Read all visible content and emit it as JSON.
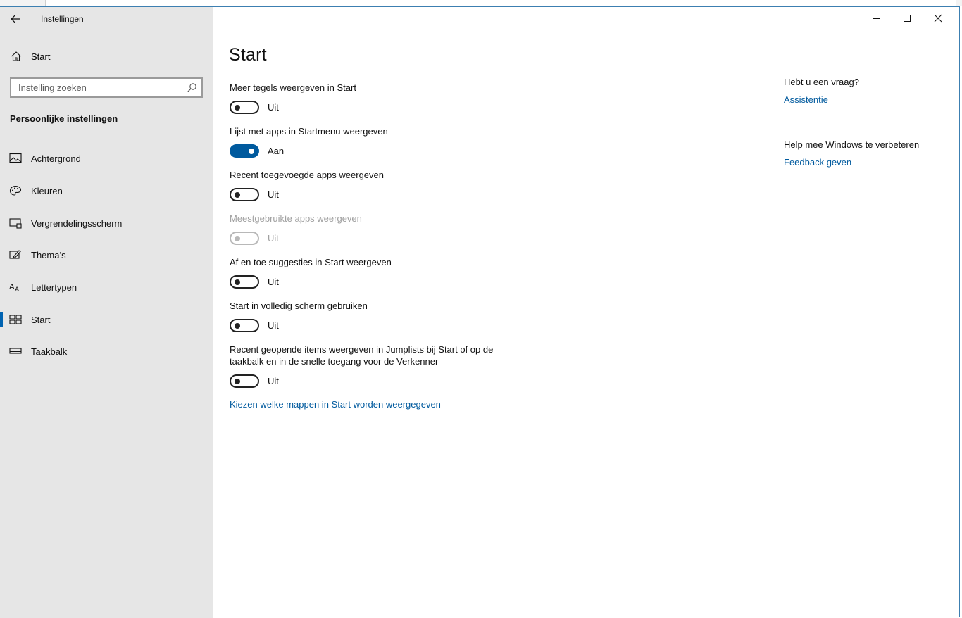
{
  "app": {
    "title": "Instellingen"
  },
  "sidebar": {
    "home_label": "Start",
    "search_placeholder": "Instelling zoeken",
    "section_heading": "Persoonlijke instellingen",
    "items": [
      {
        "label": "Achtergrond",
        "icon": "image-icon"
      },
      {
        "label": "Kleuren",
        "icon": "palette-icon"
      },
      {
        "label": "Vergrendelingsscherm",
        "icon": "lock-screen-icon"
      },
      {
        "label": "Thema’s",
        "icon": "theme-icon"
      },
      {
        "label": "Lettertypen",
        "icon": "font-icon"
      },
      {
        "label": "Start",
        "icon": "start-icon",
        "selected": true
      },
      {
        "label": "Taakbalk",
        "icon": "taskbar-icon"
      }
    ]
  },
  "main": {
    "title": "Start",
    "settings": [
      {
        "label": "Meer tegels weergeven in Start",
        "state": "Uit",
        "on": false,
        "disabled": false
      },
      {
        "label": "Lijst met apps in Startmenu weergeven",
        "state": "Aan",
        "on": true,
        "disabled": false
      },
      {
        "label": "Recent toegevoegde apps weergeven",
        "state": "Uit",
        "on": false,
        "disabled": false
      },
      {
        "label": "Meestgebruikte apps weergeven",
        "state": "Uit",
        "on": false,
        "disabled": true
      },
      {
        "label": "Af en toe suggesties in Start weergeven",
        "state": "Uit",
        "on": false,
        "disabled": false
      },
      {
        "label": "Start in volledig scherm gebruiken",
        "state": "Uit",
        "on": false,
        "disabled": false
      },
      {
        "label": "Recent geopende items weergeven in Jumplists bij Start of op de taakbalk en in de snelle toegang voor de Verkenner",
        "state": "Uit",
        "on": false,
        "disabled": false
      }
    ],
    "folders_link": "Kiezen welke mappen in Start worden weergegeven"
  },
  "help": {
    "question_heading": "Hebt u een vraag?",
    "assist_link": "Assistentie",
    "improve_heading": "Help mee Windows te verbeteren",
    "feedback_link": "Feedback geven"
  },
  "colors": {
    "accent": "#005a9e",
    "sidebar_bg": "#e6e6e6",
    "disabled": "#a0a0a0"
  }
}
